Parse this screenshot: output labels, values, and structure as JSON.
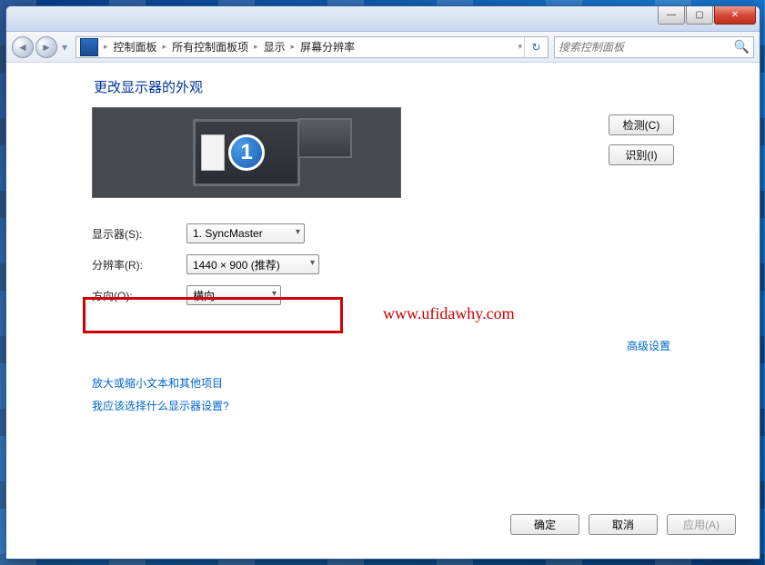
{
  "window": {
    "minimize_glyph": "—",
    "maximize_glyph": "▢",
    "close_glyph": "✕"
  },
  "nav": {
    "back_glyph": "◄",
    "forward_glyph": "►",
    "dropdown_glyph": "▾",
    "refresh_glyph": "↻"
  },
  "breadcrumb": {
    "seg1": "控制面板",
    "seg2": "所有控制面板项",
    "seg3": "显示",
    "seg4": "屏幕分辨率",
    "arrow": "▸"
  },
  "search": {
    "placeholder": "搜索控制面板",
    "icon_glyph": "🔍"
  },
  "page": {
    "title": "更改显示器的外观",
    "monitor_number": "1"
  },
  "buttons": {
    "detect": "检测(C)",
    "identify": "识别(I)",
    "ok": "确定",
    "cancel": "取消",
    "apply": "应用(A)"
  },
  "settings": {
    "display_label": "显示器(S):",
    "display_value": "1. SyncMaster",
    "resolution_label": "分辨率(R):",
    "resolution_value": "1440 × 900 (推荐)",
    "orientation_label": "方向(O):",
    "orientation_value": "横向"
  },
  "links": {
    "advanced": "高级设置",
    "zoom_text": "放大或缩小文本和其他项目",
    "which_display": "我应该选择什么显示器设置?"
  },
  "watermark": "www.ufidawhy.com"
}
